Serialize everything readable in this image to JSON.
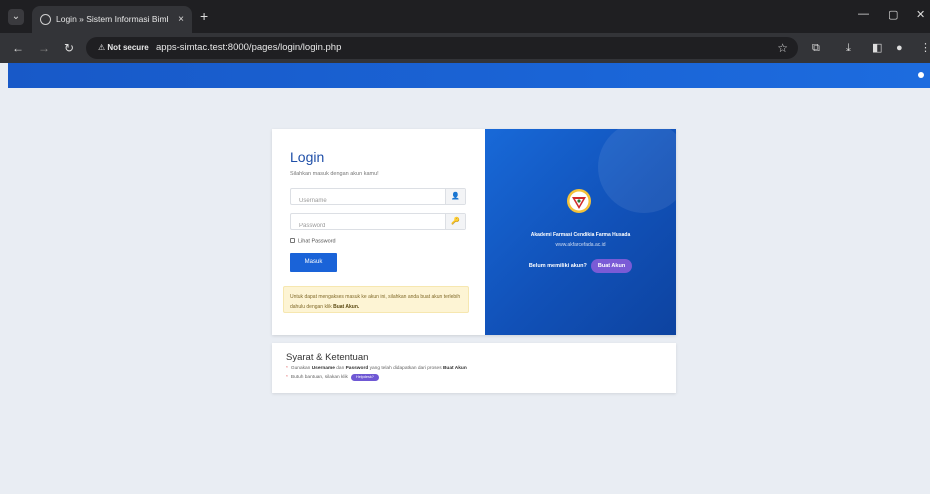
{
  "browser": {
    "tab_title": "Login » Sistem Informasi Bimbi",
    "tab_close": "×",
    "new_tab": "+",
    "security_label": "Not secure",
    "url": "apps-simtac.test:8000/pages/login/login.php"
  },
  "login": {
    "title": "Login",
    "subtitle": "Silahkan masuk dengan akun kamu!",
    "username_placeholder": "Username",
    "password_placeholder": "Password",
    "show_password_label": "Lihat Password",
    "submit_label": "Masuk",
    "alert_text": "Untuk dapat mengakses masuk ke akun ini, silahkan anda buat akun terlebih dahulu dengan klik",
    "alert_link": "Buat Akun."
  },
  "institution": {
    "name": "Akademi Farmasi Cendikia Farma Husada",
    "website": "www.akfarcefada.ac.id",
    "register_question": "Belum memiliki akun?",
    "register_button": "Buat Akun"
  },
  "terms": {
    "title": "Syarat & Ketentuan",
    "item1_pre": "Gunakan",
    "item1_username": "Username",
    "item1_mid": "dan",
    "item1_password": "Password",
    "item1_post": "yang telah didapatkan dari proses",
    "item1_link": "Buat Akun",
    "item2_text": "Butuh bantuan, silakan klik",
    "help_button": "Helpdesk?"
  }
}
